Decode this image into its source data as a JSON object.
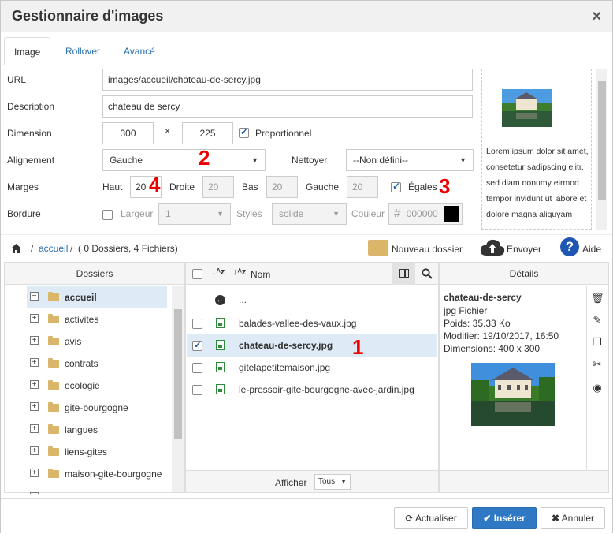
{
  "dialog": {
    "title": "Gestionnaire d'images",
    "close": "×"
  },
  "tabs": [
    "Image",
    "Rollover",
    "Avancé"
  ],
  "form": {
    "url_label": "URL",
    "url_value": "images/accueil/chateau-de-sercy.jpg",
    "desc_label": "Description",
    "desc_value": "chateau de sercy",
    "dim_label": "Dimension",
    "width": "300",
    "times": "×",
    "height": "225",
    "proportional": "Proportionnel",
    "align_label": "Alignement",
    "align_value": "Gauche",
    "clean_label": "Nettoyer",
    "clean_value": "--Non défini--",
    "margins_label": "Marges",
    "top_label": "Haut",
    "top_value": "20",
    "right_label": "Droite",
    "right_value": "20",
    "bottom_label": "Bas",
    "bottom_value": "20",
    "left_label": "Gauche",
    "left_value": "20",
    "equal_label": "Égales",
    "border_label": "Bordure",
    "width_label": "Largeur",
    "width_value": "1",
    "styles_label": "Styles",
    "styles_value": "solide",
    "color_label": "Couleur",
    "color_hash": "#",
    "color_value": "000000"
  },
  "annotations": {
    "n1": "1",
    "n2": "2",
    "n3": "3",
    "n4": "4"
  },
  "preview": {
    "text": "Lorem ipsum dolor sit amet, consetetur sadipscing elitr, sed diam nonumy eirmod tempor invidunt ut labore et dolore magna aliquyam"
  },
  "path": {
    "root": "accueil",
    "summary": "( 0 Dossiers, 4 Fichiers)",
    "slash1": "/",
    "slash2": "/"
  },
  "actions": {
    "new_folder": "Nouveau dossier",
    "upload": "Envoyer",
    "help": "Aide"
  },
  "folders_header": "Dossiers",
  "folders": [
    "accueil",
    "activites",
    "avis",
    "contrats",
    "ecologie",
    "gite-bourgogne",
    "langues",
    "liens-gites",
    "maison-gite-bourgogne"
  ],
  "files_header": {
    "name": "Nom"
  },
  "files": [
    "...",
    "balades-vallee-des-vaux.jpg",
    "chateau-de-sercy.jpg",
    "gitelapetitemaison.jpg",
    "le-pressoir-gite-bourgogne-avec-jardin.jpg"
  ],
  "files_footer": {
    "label": "Afficher",
    "value": "Tous"
  },
  "details": {
    "header": "Détails",
    "name": "chateau-de-sercy",
    "type": "jpg Fichier",
    "weight": "Poids: 35.33 Ko",
    "modified": "Modifier: 19/10/2017, 16:50",
    "dimensions": "Dimensions: 400 x 300"
  },
  "buttons": {
    "refresh": "Actualiser",
    "insert": "Insérer",
    "cancel": "Annuler"
  }
}
